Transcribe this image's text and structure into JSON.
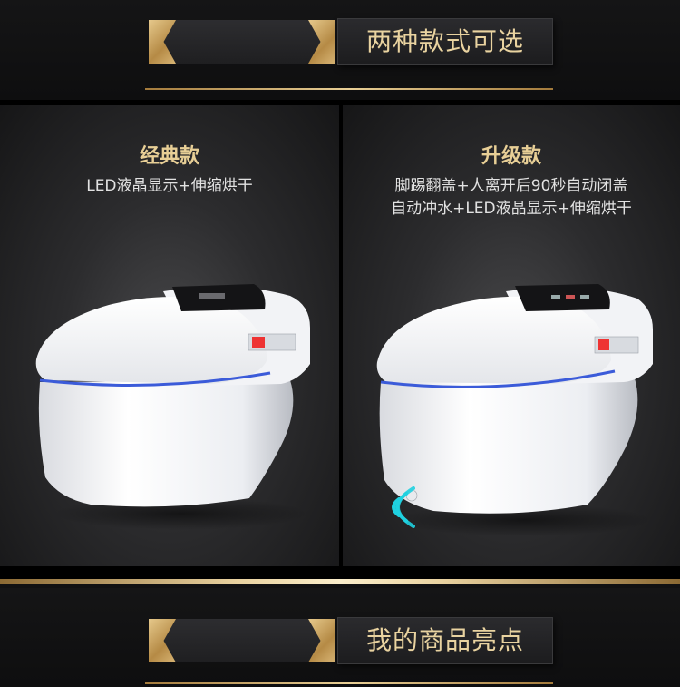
{
  "top_banner": {
    "title": "两种款式可选"
  },
  "bottom_banner": {
    "title": "我的商品亮点"
  },
  "classic": {
    "title": "经典款",
    "desc_line1": "LED液晶显示+伸缩烘干"
  },
  "upgrade": {
    "title": "升级款",
    "desc_line1": "脚踢翻盖+人离开后90秒自动闭盖",
    "desc_line2": "自动冲水+LED液晶显示+伸缩烘干"
  },
  "colors": {
    "gold": "#e8cf96",
    "background": "#111112",
    "led_blue": "#3b5bd9",
    "sensor_cyan": "#1fd0e0"
  }
}
